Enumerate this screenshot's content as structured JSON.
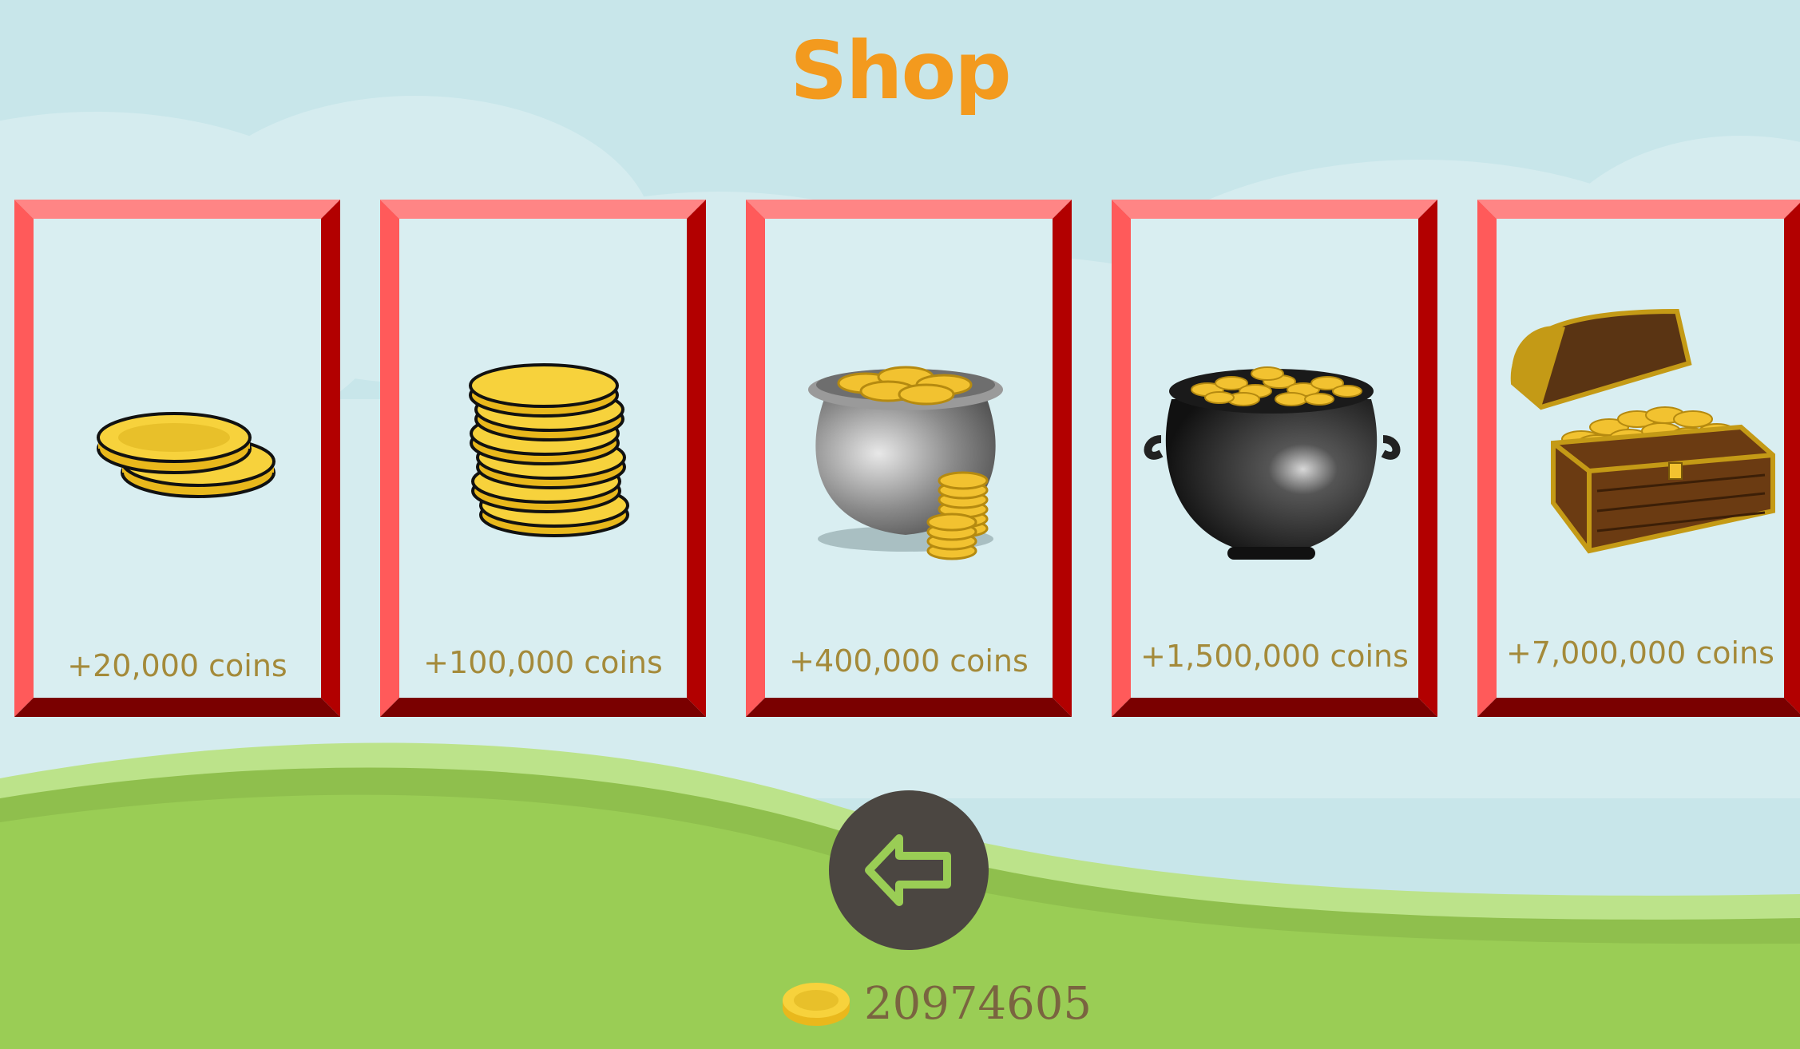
{
  "shop": {
    "title": "Shop",
    "colors": {
      "title": "#f39a1e",
      "label": "#a48a3a",
      "frame_light": "#ff5a5a",
      "frame_top": "#ff8585",
      "frame_dark": "#b20000",
      "frame_bottom": "#7a0000",
      "back_button": "#4b4641",
      "balance_text": "#7a6440",
      "grass": "#9acd55",
      "grass_light": "#bce38a",
      "sky": "#c8e6ea"
    },
    "packs": [
      {
        "label": "+20,000 coins",
        "icon": "two-coins-icon"
      },
      {
        "label": "+100,000 coins",
        "icon": "coin-stack-icon"
      },
      {
        "label": "+400,000 coins",
        "icon": "silver-pot-of-coins-icon"
      },
      {
        "label": "+1,500,000 coins",
        "icon": "black-cauldron-of-gold-icon"
      },
      {
        "label": "+7,000,000 coins",
        "icon": "treasure-chest-icon"
      }
    ],
    "back_button_icon": "back-arrow-icon",
    "balance": {
      "icon": "coin-icon",
      "amount": "20974605"
    }
  }
}
